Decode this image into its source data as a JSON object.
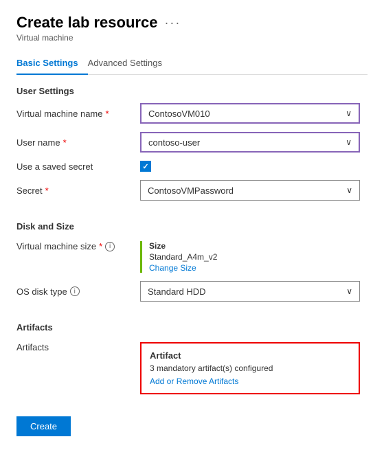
{
  "page": {
    "title": "Create lab resource",
    "ellipsis": "···",
    "subtitle": "Virtual machine"
  },
  "tabs": [
    {
      "id": "basic",
      "label": "Basic Settings",
      "active": true
    },
    {
      "id": "advanced",
      "label": "Advanced Settings",
      "active": false
    }
  ],
  "sections": {
    "userSettings": {
      "header": "User Settings",
      "vmName": {
        "label": "Virtual machine name",
        "required": true,
        "value": "ContosoVM010"
      },
      "userName": {
        "label": "User name",
        "required": true,
        "value": "contoso-user"
      },
      "savedSecret": {
        "label": "Use a saved secret",
        "checked": true
      },
      "secret": {
        "label": "Secret",
        "required": true,
        "value": "ContosoVMPassword"
      }
    },
    "diskAndSize": {
      "header": "Disk and Size",
      "vmSize": {
        "label": "Virtual machine size",
        "required": true,
        "sizeTitle": "Size",
        "sizeValue": "Standard_A4m_v2",
        "changeLink": "Change Size"
      },
      "osDiskType": {
        "label": "OS disk type",
        "value": "Standard HDD"
      }
    },
    "artifacts": {
      "header": "Artifacts",
      "label": "Artifacts",
      "boxTitle": "Artifact",
      "count": "3 mandatory artifact(s) configured",
      "addRemoveLink": "Add or Remove Artifacts"
    }
  },
  "buttons": {
    "create": "Create"
  },
  "icons": {
    "chevron": "∨",
    "info": "i",
    "check": "✓"
  }
}
